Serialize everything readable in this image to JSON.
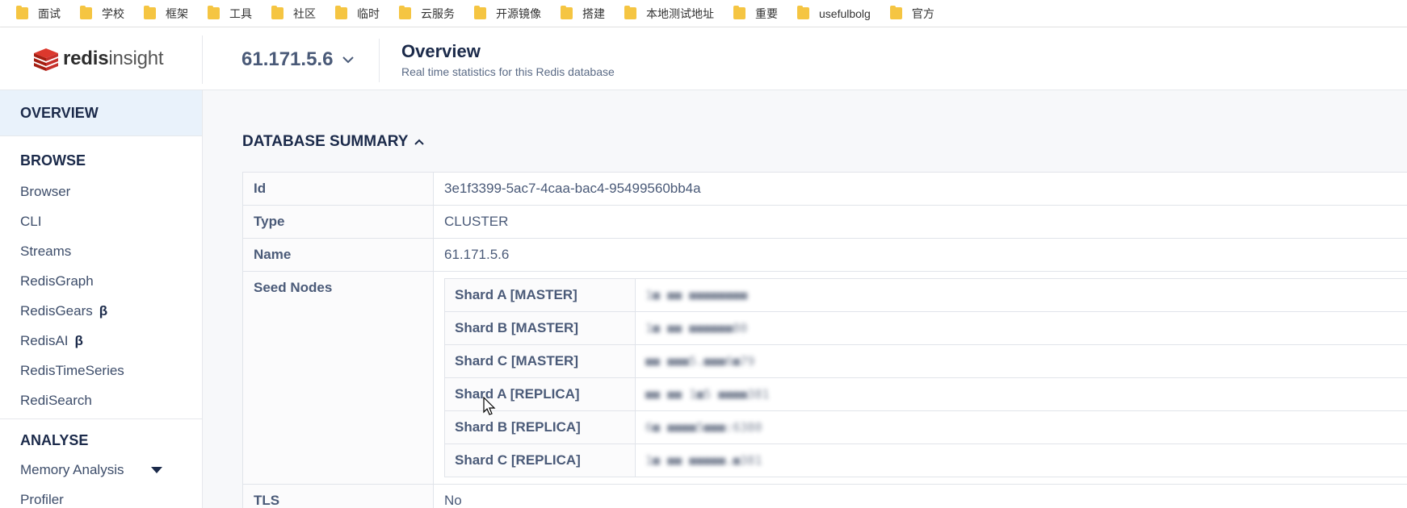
{
  "bookmarks": [
    "面试",
    "学校",
    "框架",
    "工具",
    "社区",
    "临时",
    "云服务",
    "开源镜像",
    "搭建",
    "本地测试地址",
    "重要",
    "usefulbolg",
    "官方"
  ],
  "logo": {
    "bold": "redis",
    "light": "insight"
  },
  "header": {
    "db_name": "61.171.5.6",
    "title": "Overview",
    "subtitle": "Real time statistics for this Redis database"
  },
  "sidebar": {
    "overview": "OVERVIEW",
    "browse_title": "BROWSE",
    "browse_items": [
      "Browser",
      "CLI",
      "Streams",
      "RedisGraph",
      "RedisGears",
      "RedisAI",
      "RedisTimeSeries",
      "RediSearch"
    ],
    "beta_symbol": "β",
    "analyse_title": "ANALYSE",
    "analyse_items": [
      "Memory Analysis",
      "Profiler"
    ]
  },
  "summary": {
    "title": "DATABASE SUMMARY",
    "rows": {
      "id": {
        "label": "Id",
        "value": "3e1f3399-5ac7-4caa-bac4-95499560bb4a"
      },
      "type": {
        "label": "Type",
        "value": "CLUSTER"
      },
      "name": {
        "label": "Name",
        "value": "61.171.5.6"
      },
      "seed": {
        "label": "Seed Nodes"
      },
      "tls": {
        "label": "TLS",
        "value": "No"
      }
    },
    "seed_nodes": [
      {
        "label": "Shard A [MASTER]",
        "value": "1■ ■■ ■■■■■■■■"
      },
      {
        "label": "Shard B [MASTER]",
        "value": "1■ ■■ ■■■■■■80"
      },
      {
        "label": "Shard C [MASTER]",
        "value": "■■ ■■■5.■■■6■79"
      },
      {
        "label": "Shard A [REPLICA]",
        "value": "■■ ■■ 1■5 ■■■■381"
      },
      {
        "label": "Shard B [REPLICA]",
        "value": "6■ ■■■■5■■■:6380"
      },
      {
        "label": "Shard C [REPLICA]",
        "value": "1■ ■■ ■■■■■.■381"
      }
    ]
  }
}
